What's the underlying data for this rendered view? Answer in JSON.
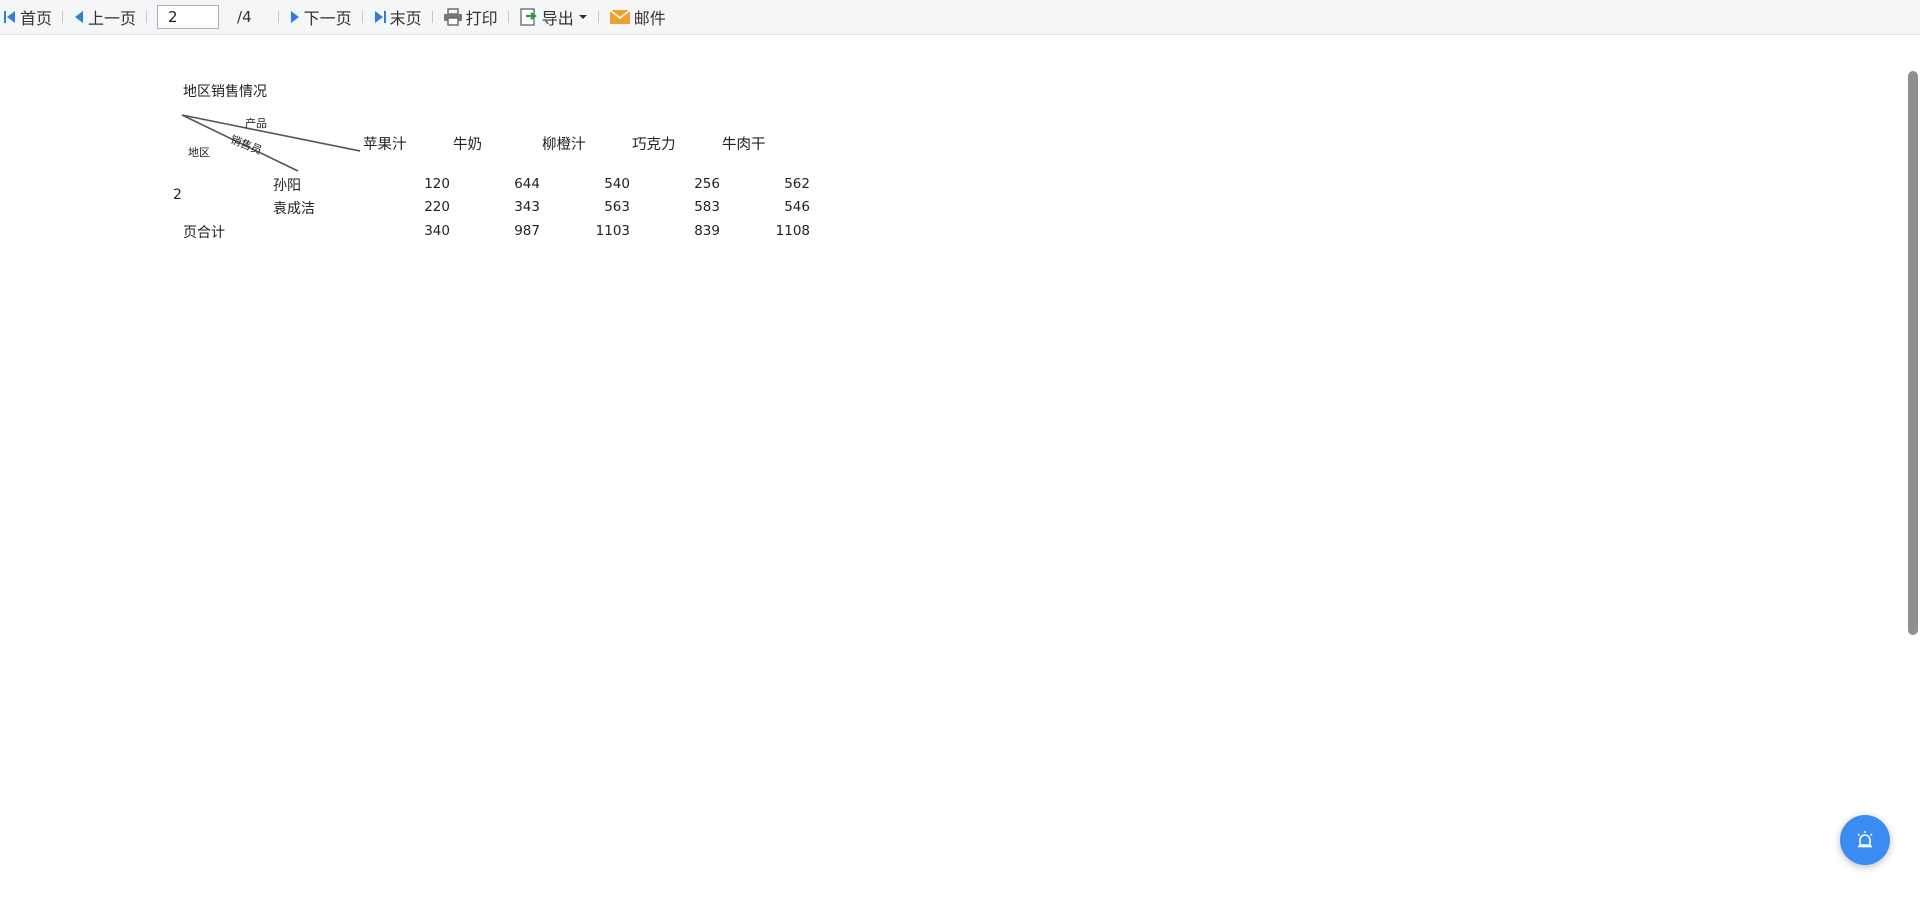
{
  "toolbar": {
    "first_label": "首页",
    "prev_label": "上一页",
    "page_value": "2",
    "page_total": "/4",
    "next_label": "下一页",
    "last_label": "末页",
    "print_label": "打印",
    "export_label": "导出",
    "mail_label": "邮件"
  },
  "report": {
    "title": "地区销售情况",
    "corner": {
      "product": "产品",
      "salesperson": "销售员",
      "region": "地区"
    },
    "columns": [
      "苹果汁",
      "牛奶",
      "柳橙汁",
      "巧克力",
      "牛肉干"
    ],
    "region_value": "2",
    "rows": [
      {
        "name": "孙阳",
        "values": [
          "120",
          "644",
          "540",
          "256",
          "562"
        ]
      },
      {
        "name": "袁成洁",
        "values": [
          "220",
          "343",
          "563",
          "583",
          "546"
        ]
      }
    ],
    "total": {
      "label": "页合计",
      "values": [
        "340",
        "987",
        "1103",
        "839",
        "1108"
      ]
    }
  },
  "colors": {
    "accent": "#3a8bf2",
    "icon_blue": "#2f7fd8",
    "export_green": "#2e9a3e",
    "mail_orange": "#f0a030"
  }
}
